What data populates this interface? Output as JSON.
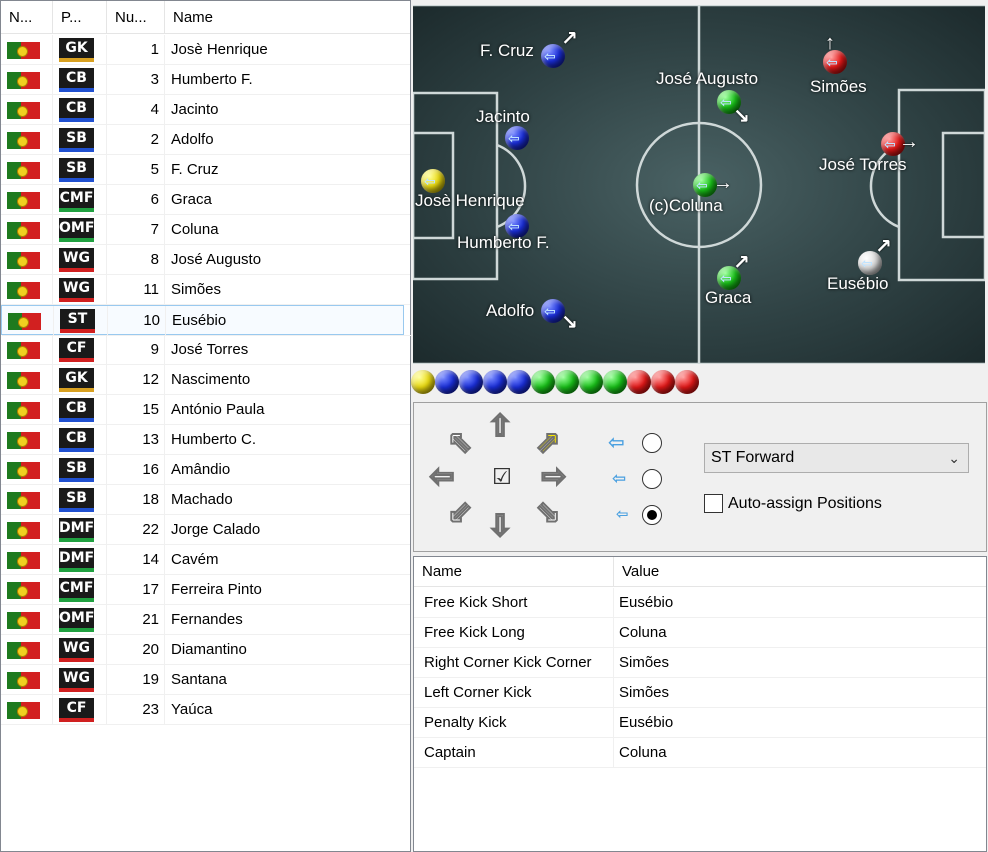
{
  "roster": {
    "headers": [
      "N...",
      "P...",
      "Nu...",
      "Name"
    ],
    "players": [
      {
        "pos": "GK",
        "pos_color": "#d8a020",
        "num": "1",
        "name": "Josè Henrique"
      },
      {
        "pos": "CB",
        "pos_color": "#2050d0",
        "num": "3",
        "name": "Humberto F."
      },
      {
        "pos": "CB",
        "pos_color": "#2050d0",
        "num": "4",
        "name": "Jacinto"
      },
      {
        "pos": "SB",
        "pos_color": "#2050d0",
        "num": "2",
        "name": "Adolfo"
      },
      {
        "pos": "SB",
        "pos_color": "#2050d0",
        "num": "5",
        "name": "F. Cruz"
      },
      {
        "pos": "CMF",
        "pos_color": "#20a040",
        "num": "6",
        "name": "Graca"
      },
      {
        "pos": "OMF",
        "pos_color": "#20a040",
        "num": "7",
        "name": "Coluna"
      },
      {
        "pos": "WG",
        "pos_color": "#d02020",
        "num": "8",
        "name": "José Augusto"
      },
      {
        "pos": "WG",
        "pos_color": "#d02020",
        "num": "11",
        "name": "Simões"
      },
      {
        "pos": "ST",
        "pos_color": "#d02020",
        "num": "10",
        "name": "Eusébio",
        "selected": true
      },
      {
        "pos": "CF",
        "pos_color": "#d02020",
        "num": "9",
        "name": "José Torres"
      },
      {
        "pos": "GK",
        "pos_color": "#d8a020",
        "num": "12",
        "name": "Nascimento"
      },
      {
        "pos": "CB",
        "pos_color": "#2050d0",
        "num": "15",
        "name": "António Paula"
      },
      {
        "pos": "CB",
        "pos_color": "#2050d0",
        "num": "13",
        "name": "Humberto C."
      },
      {
        "pos": "SB",
        "pos_color": "#2050d0",
        "num": "16",
        "name": "Amândio"
      },
      {
        "pos": "SB",
        "pos_color": "#2050d0",
        "num": "18",
        "name": "Machado"
      },
      {
        "pos": "DMF",
        "pos_color": "#20a040",
        "num": "22",
        "name": "Jorge Calado"
      },
      {
        "pos": "DMF",
        "pos_color": "#20a040",
        "num": "14",
        "name": "Cavém"
      },
      {
        "pos": "CMF",
        "pos_color": "#20a040",
        "num": "17",
        "name": "Ferreira Pinto"
      },
      {
        "pos": "OMF",
        "pos_color": "#20a040",
        "num": "21",
        "name": "Fernandes"
      },
      {
        "pos": "WG",
        "pos_color": "#d02020",
        "num": "20",
        "name": "Diamantino"
      },
      {
        "pos": "WG",
        "pos_color": "#d02020",
        "num": "19",
        "name": "Santana"
      },
      {
        "pos": "CF",
        "pos_color": "#d02020",
        "num": "23",
        "name": "Yaúca"
      }
    ]
  },
  "pitch": {
    "players": [
      {
        "label": "F. Cruz",
        "color": "blue",
        "dir": "↗"
      },
      {
        "label": "Jacinto",
        "color": "blue",
        "dir": ""
      },
      {
        "label": "Josè Henrique",
        "color": "yellow",
        "dir": ""
      },
      {
        "label": "Humberto F.",
        "color": "blue",
        "dir": ""
      },
      {
        "label": "Adolfo",
        "color": "blue",
        "dir": "↘"
      },
      {
        "label": "José Augusto",
        "color": "green",
        "dir": "↘"
      },
      {
        "label": "(c)Coluna",
        "color": "green",
        "dir": "→"
      },
      {
        "label": "Graca",
        "color": "green",
        "dir": "↗"
      },
      {
        "label": "Simões",
        "color": "red",
        "dir": "↑"
      },
      {
        "label": "José Torres",
        "color": "red",
        "dir": "→"
      },
      {
        "label": "Eusébio",
        "color": "white",
        "dir": "↗"
      }
    ]
  },
  "formation_balls": [
    "yellow",
    "blue",
    "blue",
    "blue",
    "blue",
    "green",
    "green",
    "green",
    "green",
    "red",
    "red",
    "red"
  ],
  "controls": {
    "directions": {
      "up_left": "⇖",
      "up": "⇧",
      "up_right": "⇗",
      "left": "⇦",
      "center": "☑",
      "right": "⇨",
      "down_left": "⇙",
      "down": "⇩",
      "down_right": "⇘"
    },
    "kick_options": [
      {
        "arrow": "⇦",
        "selected": false
      },
      {
        "arrow": "⇦",
        "selected": false
      },
      {
        "arrow": "⇦",
        "selected": true
      }
    ],
    "role_select": {
      "value": "ST Forward",
      "chevron": "⌄"
    },
    "auto_assign": {
      "label": "Auto-assign Positions",
      "checked": false
    }
  },
  "set_pieces": {
    "headers": [
      "Name",
      "Value"
    ],
    "rows": [
      {
        "name": "Free Kick Short",
        "value": "Eusébio"
      },
      {
        "name": "Free Kick Long",
        "value": "Coluna"
      },
      {
        "name": "Right Corner Kick Corner",
        "value": "Simões"
      },
      {
        "name": "Left Corner Kick",
        "value": "Simões"
      },
      {
        "name": "Penalty Kick",
        "value": "Eusébio"
      },
      {
        "name": "Captain",
        "value": "Coluna"
      }
    ]
  }
}
